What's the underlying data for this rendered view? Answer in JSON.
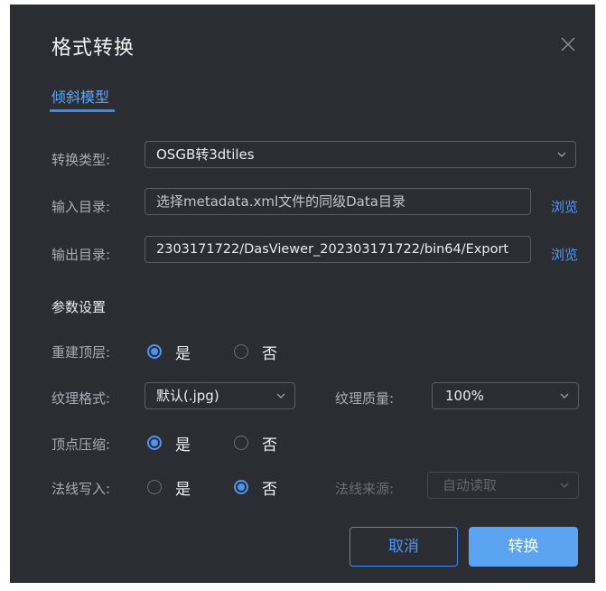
{
  "dialog": {
    "title": "格式转换",
    "close_icon": "close-icon",
    "tab": "倾斜模型",
    "convert_type": {
      "label": "转换类型:",
      "value": "OSGB转3dtiles"
    },
    "input_dir": {
      "label": "输入目录:",
      "placeholder": "选择metadata.xml文件的同级Data目录",
      "browse": "浏览"
    },
    "output_dir": {
      "label": "输出目录:",
      "value": "2303171722/DasViewer_202303171722/bin64/Export",
      "browse": "浏览"
    },
    "params_title": "参数设置",
    "rebuild_top": {
      "label": "重建顶层:",
      "yes": "是",
      "no": "否",
      "selected": "yes"
    },
    "texture_format": {
      "label": "纹理格式:",
      "value": "默认(.jpg)"
    },
    "texture_quality": {
      "label": "纹理质量:",
      "value": "100%"
    },
    "vertex_compress": {
      "label": "顶点压缩:",
      "yes": "是",
      "no": "否",
      "selected": "yes"
    },
    "normal_write": {
      "label": "法线写入:",
      "yes": "是",
      "no": "否",
      "selected": "no"
    },
    "normal_source": {
      "label": "法线来源:",
      "value": "自动读取"
    },
    "cancel": "取消",
    "convert": "转换"
  },
  "colors": {
    "accent": "#3d8af0",
    "background": "#2b2d32",
    "primary_button": "#5aa4f2"
  }
}
